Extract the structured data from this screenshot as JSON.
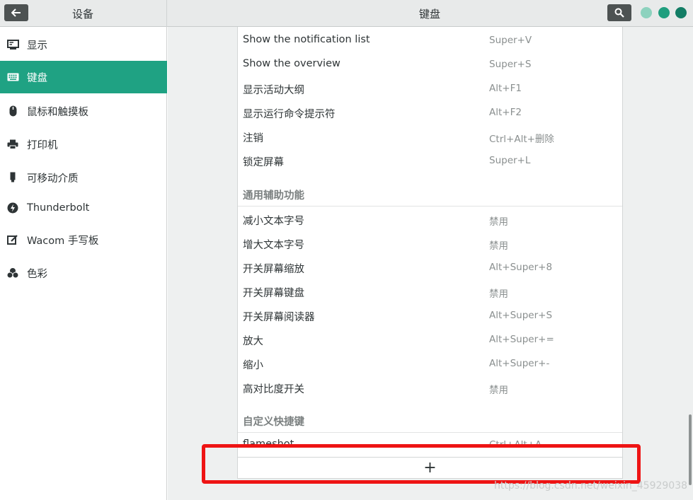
{
  "header": {
    "left_title": "设备",
    "center_title": "键盘"
  },
  "sidebar": {
    "items": [
      {
        "label": "显示",
        "icon": "display-icon"
      },
      {
        "label": "键盘",
        "icon": "keyboard-icon",
        "active": true
      },
      {
        "label": "鼠标和触摸板",
        "icon": "mouse-icon"
      },
      {
        "label": "打印机",
        "icon": "printer-icon"
      },
      {
        "label": "可移动介质",
        "icon": "usb-icon"
      },
      {
        "label": "Thunderbolt",
        "icon": "thunderbolt-icon"
      },
      {
        "label": "Wacom 手写板",
        "icon": "tablet-icon"
      },
      {
        "label": "色彩",
        "icon": "color-icon"
      }
    ]
  },
  "shortcuts": {
    "system": [
      {
        "name": "Show the notification list",
        "accel": "Super+V"
      },
      {
        "name": "Show the overview",
        "accel": "Super+S"
      },
      {
        "name": "显示活动大纲",
        "accel": "Alt+F1"
      },
      {
        "name": "显示运行命令提示符",
        "accel": "Alt+F2"
      },
      {
        "name": "注销",
        "accel": "Ctrl+Alt+删除"
      },
      {
        "name": "锁定屏幕",
        "accel": "Super+L"
      }
    ],
    "accessibility_title": "通用辅助功能",
    "accessibility": [
      {
        "name": "减小文本字号",
        "accel": "禁用"
      },
      {
        "name": "增大文本字号",
        "accel": "禁用"
      },
      {
        "name": "开关屏幕缩放",
        "accel": "Alt+Super+8"
      },
      {
        "name": "开关屏幕键盘",
        "accel": "禁用"
      },
      {
        "name": "开关屏幕阅读器",
        "accel": "Alt+Super+S"
      },
      {
        "name": "放大",
        "accel": "Alt+Super+="
      },
      {
        "name": "缩小",
        "accel": "Alt+Super+-"
      },
      {
        "name": "高对比度开关",
        "accel": "禁用"
      }
    ],
    "custom_title": "自定义快捷键",
    "custom": [
      {
        "name": "flameshot",
        "accel": "Ctrl+Alt+A"
      }
    ],
    "add_label": "+"
  },
  "watermark": "https://blog.csdn.net/weixin_45929038",
  "colors": {
    "accent": "#1fa283",
    "highlight": "#ee1414"
  }
}
